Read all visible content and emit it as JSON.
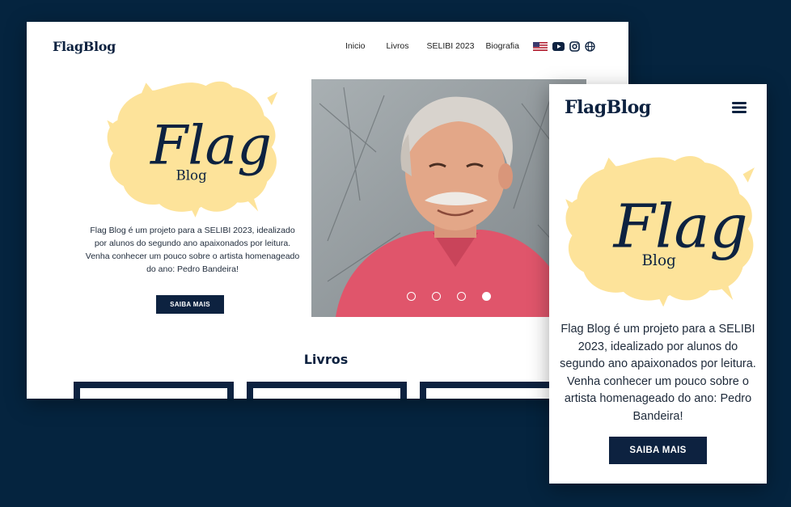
{
  "brand": "FlagBlog",
  "logo": {
    "main": "Flag",
    "sub": "Blog"
  },
  "colors": {
    "navy": "#0d2240",
    "background": "#05243f",
    "splash": "#fde39a",
    "photo_shirt": "#e0556b"
  },
  "desktop": {
    "nav": [
      "Inicio",
      "Livros",
      "SELIBI 2023",
      "Biografia"
    ],
    "icons": [
      "us-flag-icon",
      "youtube-icon",
      "instagram-icon",
      "globe-icon"
    ],
    "description": "Flag Blog é um projeto para a SELIBI 2023, idealizado por alunos do segundo ano apaixonados por leitura. Venha conhecer um pouco sobre o artista homenageado do ano: Pedro Bandeira!",
    "button": "SAIBA MAIS",
    "carousel": {
      "slides": 4,
      "active_index": 3
    },
    "section_title": "Livros"
  },
  "mobile": {
    "menu_icon": "hamburger-menu-icon",
    "description": "Flag Blog é um projeto para a SELIBI 2023, idealizado por alunos do segundo ano apaixonados por leitura. Venha conhecer um pouco sobre o artista homenageado do ano: Pedro Bandeira!",
    "button": "SAIBA MAIS"
  }
}
